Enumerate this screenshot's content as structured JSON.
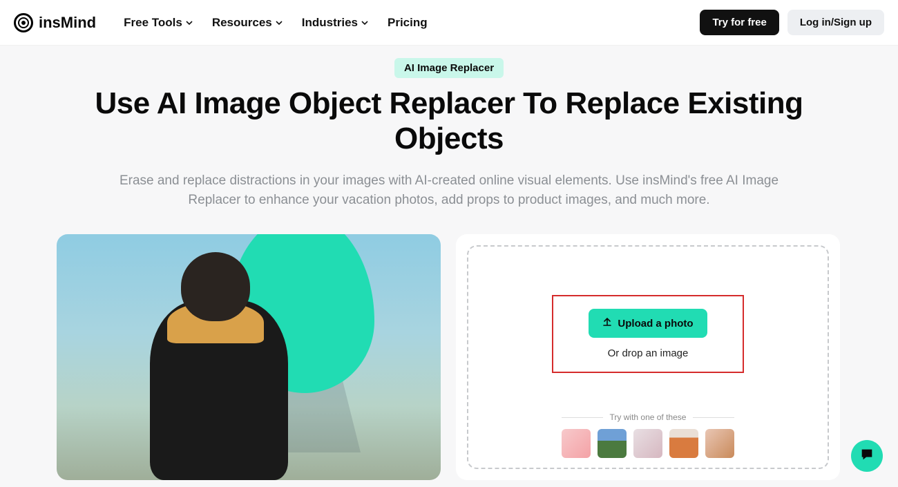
{
  "brand": "insMind",
  "nav": {
    "free_tools": "Free Tools",
    "resources": "Resources",
    "industries": "Industries",
    "pricing": "Pricing"
  },
  "actions": {
    "try": "Try for free",
    "login": "Log in/Sign up"
  },
  "hero": {
    "badge": "AI Image Replacer",
    "title": "Use AI Image Object Replacer To Replace Existing Objects",
    "subtitle": "Erase and replace distractions in your images with AI-created online visual elements. Use insMind's free AI Image Replacer to enhance your vacation photos, add props to product images, and much more."
  },
  "upload": {
    "button": "Upload a photo",
    "or_drop": "Or drop an image",
    "try_label": "Try with one of these"
  },
  "colors": {
    "accent": "#21dcb3",
    "highlight_border": "#d52b2b"
  }
}
